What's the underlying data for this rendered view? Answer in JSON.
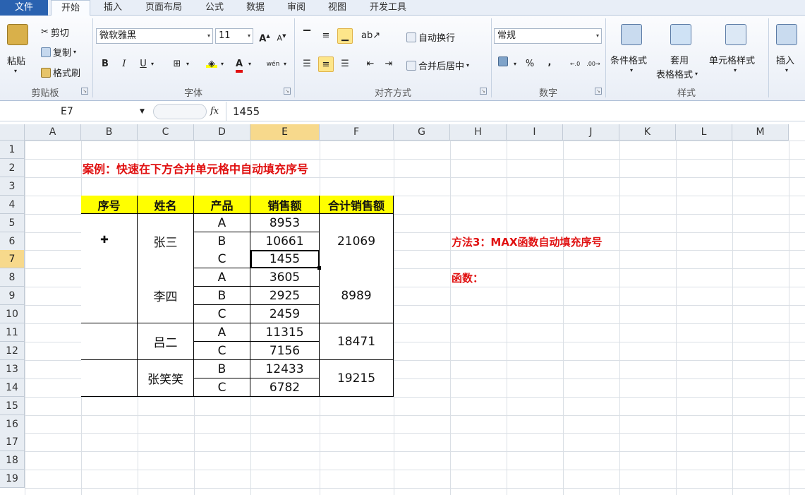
{
  "tabs": {
    "file": "文件",
    "home": "开始",
    "insert": "插入",
    "layout": "页面布局",
    "formulas": "公式",
    "data": "数据",
    "review": "审阅",
    "view": "视图",
    "developer": "开发工具"
  },
  "clipboard": {
    "paste": "粘贴",
    "cut": "剪切",
    "copy": "复制",
    "format_painter": "格式刷",
    "label": "剪贴板"
  },
  "font": {
    "name": "微软雅黑",
    "size": "11",
    "grow": "A",
    "shrink": "A",
    "bold": "B",
    "italic": "I",
    "underline": "U",
    "font_color_letter": "A",
    "phonetic": "wén",
    "label": "字体"
  },
  "alignment": {
    "wrap": "自动换行",
    "merge": "合并后居中",
    "label": "对齐方式"
  },
  "number": {
    "format": "常规",
    "percent": "%",
    "comma": ",",
    "label": "数字"
  },
  "styles": {
    "conditional": "条件格式",
    "table_format_1": "套用",
    "table_format_2": "表格格式",
    "cell_styles": "单元格样式",
    "label": "样式"
  },
  "cells": {
    "insert": "插入"
  },
  "formula_bar": {
    "name_box": "E7",
    "fx": "fx",
    "value": "1455"
  },
  "columns": [
    "A",
    "B",
    "C",
    "D",
    "E",
    "F",
    "G",
    "H",
    "I",
    "J",
    "K",
    "L",
    "M"
  ],
  "rows": [
    "1",
    "2",
    "3",
    "4",
    "5",
    "6",
    "7",
    "8",
    "9",
    "10",
    "11",
    "12",
    "13",
    "14",
    "15",
    "16",
    "17",
    "18",
    "19"
  ],
  "sheet": {
    "title": "案例：快速在下方合并单元格中自动填充序号",
    "method": "方法3：MAX函数自动填充序号",
    "func_label": "函数：",
    "headers": [
      "序号",
      "姓名",
      "产品",
      "销售额",
      "合计销售额"
    ],
    "names": [
      "张三",
      "李四",
      "吕二",
      "张笑笑"
    ],
    "products": [
      "A",
      "B",
      "C",
      "A",
      "B",
      "C",
      "A",
      "C",
      "B",
      "C"
    ],
    "sales": [
      "8953",
      "10661",
      "1455",
      "3605",
      "2925",
      "2459",
      "11315",
      "7156",
      "12433",
      "6782"
    ],
    "totals": [
      "21069",
      "8989",
      "18471",
      "19215"
    ]
  },
  "colors": {
    "accent": "#2a62b0",
    "highlight": "#ffff00",
    "red_text": "#e01010",
    "selected_header": "#f7d98c"
  }
}
